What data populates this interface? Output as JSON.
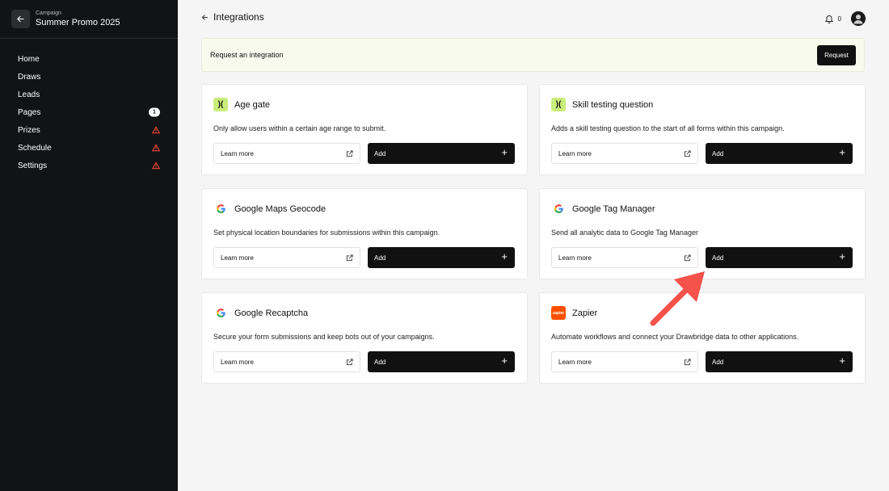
{
  "sidebar": {
    "campaign_label": "Campaign",
    "campaign_name": "Summer Promo 2025",
    "nav": [
      {
        "label": "Home"
      },
      {
        "label": "Draws"
      },
      {
        "label": "Leads"
      },
      {
        "label": "Pages",
        "badge": "1"
      },
      {
        "label": "Prizes",
        "status": "warning"
      },
      {
        "label": "Schedule",
        "status": "warning"
      },
      {
        "label": "Settings",
        "status": "warning"
      }
    ]
  },
  "header": {
    "title": "Integrations",
    "notification_count": "0"
  },
  "banner": {
    "text": "Request an integration",
    "button_label": "Request"
  },
  "cards": [
    {
      "name": "Age gate",
      "icon": "code-bracket-icon",
      "description": "Only allow users within a certain age range to submit.",
      "learn_label": "Learn more",
      "add_label": "Add"
    },
    {
      "name": "Skill testing question",
      "icon": "code-bracket-icon",
      "description": "Adds a skill testing question to the start of all forms within this campaign.",
      "learn_label": "Learn more",
      "add_label": "Add"
    },
    {
      "name": "Google Maps Geocode",
      "icon": "google-icon",
      "description": "Set physical location boundaries for submissions within this campaign.",
      "learn_label": "Learn more",
      "add_label": "Add"
    },
    {
      "name": "Google Tag Manager",
      "icon": "google-icon",
      "description": "Send all analytic data to Google Tag Manager",
      "learn_label": "Learn more",
      "add_label": "Add"
    },
    {
      "name": "Google Recaptcha",
      "icon": "google-icon",
      "description": "Secure your form submissions and keep bots out of your campaigns.",
      "learn_label": "Learn more",
      "add_label": "Add"
    },
    {
      "name": "Zapier",
      "icon": "zapier-icon",
      "icon_text": "zapier",
      "description": "Automate workflows and connect your Drawbridge data to other applications.",
      "learn_label": "Learn more",
      "add_label": "Add"
    }
  ],
  "colors": {
    "sidebar_bg": "#121314",
    "accent_lime": "#c9ec7a",
    "warning": "#ff4b3e",
    "zapier": "#ff4f00",
    "annotation_arrow": "#f4524a"
  }
}
